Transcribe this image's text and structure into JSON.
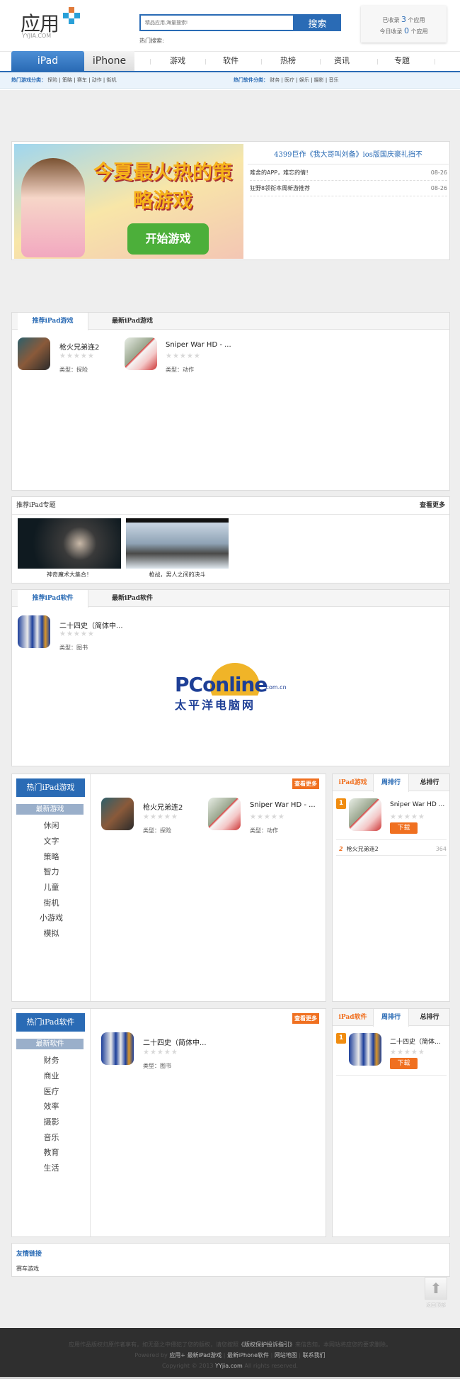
{
  "header": {
    "logo_text": "应用",
    "logo_sub": "YYJIA.COM",
    "search_placeholder": "精品应用,海量搜索!",
    "search_button": "搜索",
    "hot_search_label": "热门搜索:",
    "stats": {
      "total_prefix": "已收录",
      "total_count": "3",
      "total_suffix": "个应用",
      "today_prefix": "今日收录",
      "today_count": "0",
      "today_suffix": "个应用"
    }
  },
  "nav": {
    "tabs": [
      {
        "label": "iPad"
      },
      {
        "label": "iPhone"
      }
    ],
    "items": [
      {
        "label": "游戏"
      },
      {
        "label": "软件"
      },
      {
        "label": "热榜"
      },
      {
        "label": "资讯"
      },
      {
        "label": "专题"
      }
    ]
  },
  "subnav": {
    "games_label": "热门游戏分类：",
    "games": [
      "探险",
      "策略",
      "赛车",
      "动作",
      "街机"
    ],
    "soft_label": "热门软件分类：",
    "soft": [
      "财务",
      "医疗",
      "娱乐",
      "摄影",
      "音乐"
    ]
  },
  "banner": {
    "image_text": "今夏最火热的策略游戏",
    "image_button": "开始游戏",
    "headline": "4399巨作《我大哥叫刘备》ios版国庆豪礼挡不",
    "news": [
      {
        "title": "难舍的APP，难忘的情！",
        "date": "08-26"
      },
      {
        "title": "狂野8领衔本周新游推荐",
        "date": "08-26"
      }
    ]
  },
  "rec_games": {
    "tabs": [
      "推荐iPad游戏",
      "最新iPad游戏"
    ],
    "items": [
      {
        "title": "枪火兄弟连2",
        "type": "类型：探险",
        "icon": "brothers"
      },
      {
        "title": "Sniper War HD - ...",
        "type": "类型：动作",
        "icon": "sniper"
      }
    ]
  },
  "topics": {
    "title": "推荐iPad专题",
    "more": "查看更多",
    "items": [
      {
        "caption": "神奇魔术大集合！"
      },
      {
        "caption": "枪战，男人之间的决斗"
      }
    ]
  },
  "rec_soft": {
    "tabs": [
      "推荐iPad软件",
      "最新iPad软件"
    ],
    "items": [
      {
        "title": "二十四史（简体中...",
        "type": "类型：图书",
        "icon": "book"
      }
    ]
  },
  "watermark": {
    "en": "PConline",
    "domain": ".com.cn",
    "cn": "太平洋电脑网"
  },
  "hot_games": {
    "title": "热门iPad游戏",
    "more": "查看更多",
    "categories": [
      "最新游戏",
      "休闲",
      "文字",
      "策略",
      "智力",
      "儿童",
      "街机",
      "小游戏",
      "模拟"
    ],
    "items": [
      {
        "title": "枪火兄弟连2",
        "type": "类型：探险"
      },
      {
        "title": "Sniper War HD - ...",
        "type": "类型：动作"
      }
    ],
    "rank": {
      "tabs": [
        "iPad游戏",
        "周排行",
        "总排行"
      ],
      "top": {
        "rank": "1",
        "title": "Sniper War HD ...",
        "download": "下载"
      },
      "rows": [
        {
          "rank": "2",
          "title": "枪火兄弟连2",
          "count": "364"
        }
      ]
    }
  },
  "hot_soft": {
    "title": "热门iPad软件",
    "more": "查看更多",
    "categories": [
      "最新软件",
      "财务",
      "商业",
      "医疗",
      "效率",
      "摄影",
      "音乐",
      "教育",
      "生活"
    ],
    "items": [
      {
        "title": "二十四史（简体中...",
        "type": "类型：图书"
      }
    ],
    "rank": {
      "tabs": [
        "iPad软件",
        "周排行",
        "总排行"
      ],
      "top": {
        "rank": "1",
        "title": "二十四史（简体...",
        "download": "下载"
      }
    }
  },
  "links": {
    "title": "友情链接",
    "items": [
      "赛车游戏"
    ]
  },
  "back_top": "返回顶部",
  "footer": {
    "line1_a": "应用作品版权归原作者享有，如无意之中侵犯了您的版权，请您按照",
    "line1_link": "《版权保护投诉指引》",
    "line1_b": "来信告知，本网站将应您的要求删除。",
    "powered": "Powered by",
    "links": [
      "应用+",
      "最新iPad游戏",
      "最新iPhone软件",
      "网站地图",
      "联系我们"
    ],
    "copy_a": "Copyright © 2013",
    "copy_site": "YYjia.com",
    "copy_b": "All rights reserved."
  },
  "colors": {
    "brand_blue": "#2a6bb5",
    "orange": "#f07020",
    "footer_bg": "#2f2f2f"
  }
}
